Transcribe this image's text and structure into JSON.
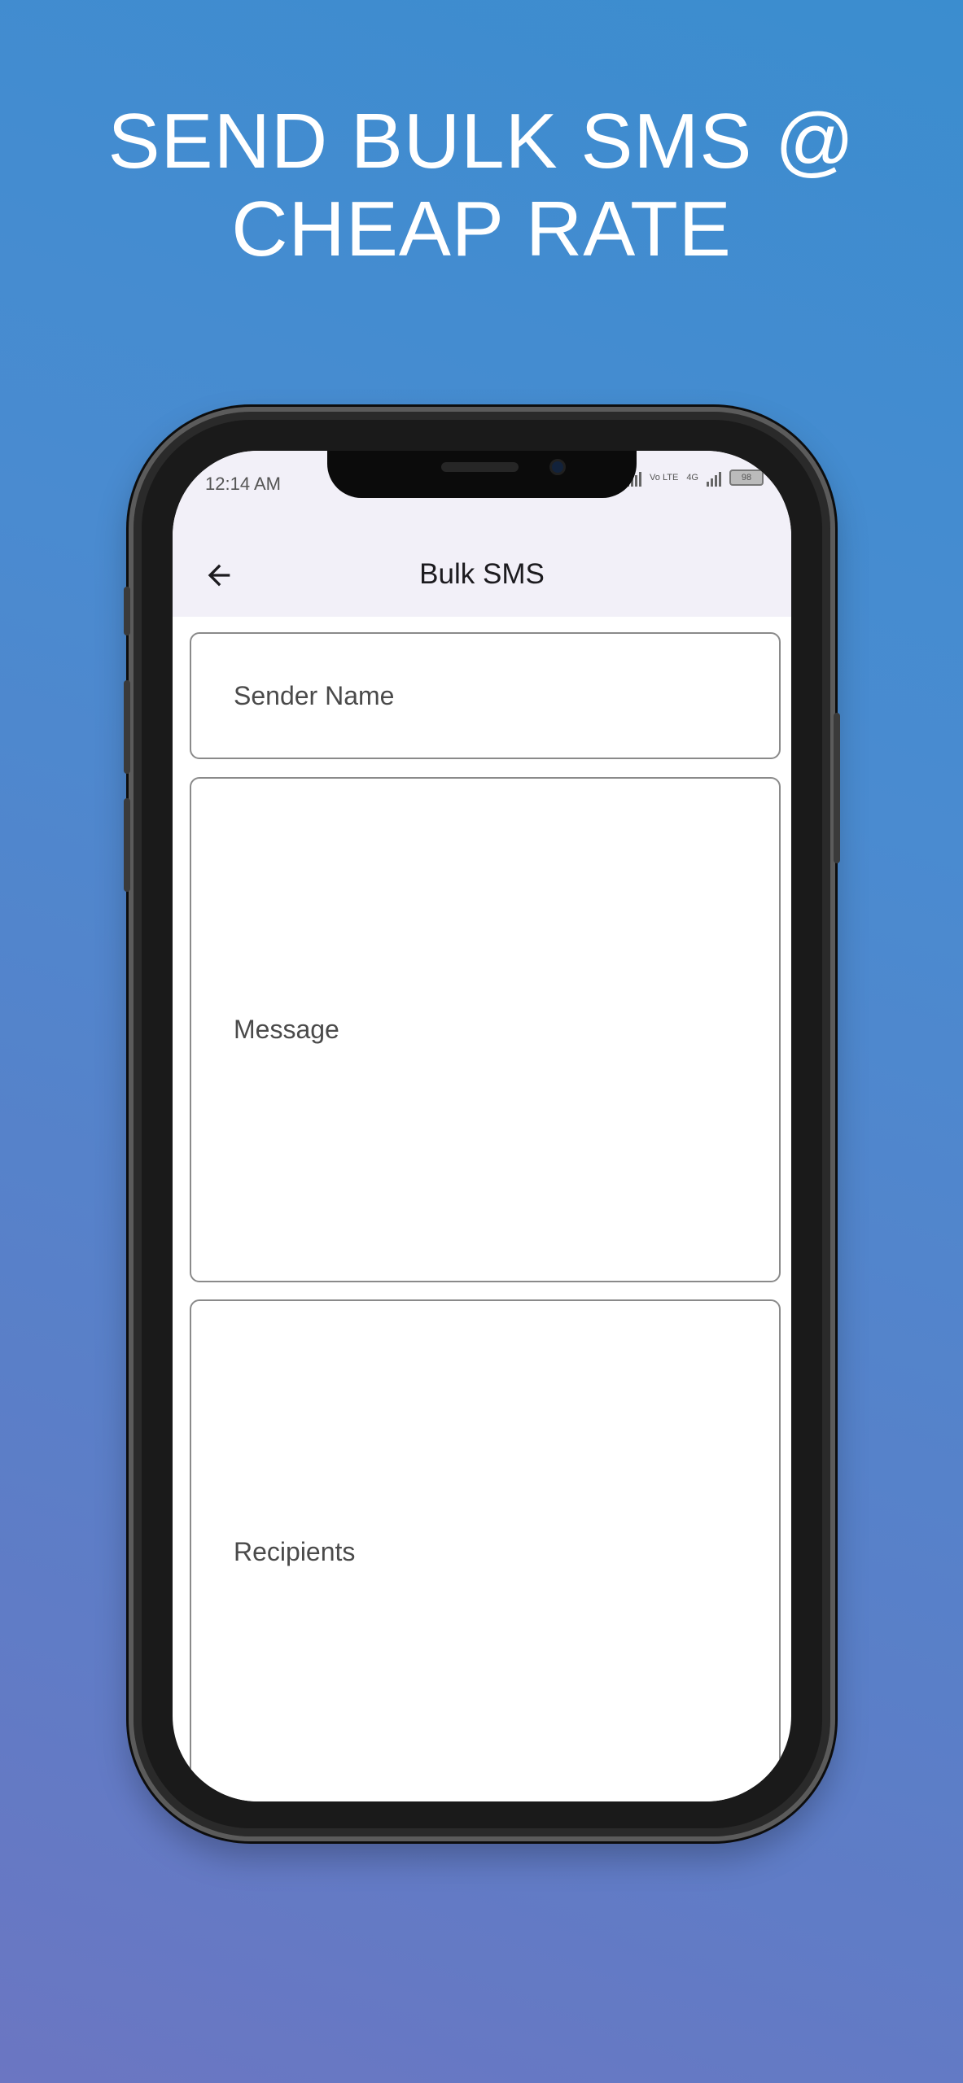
{
  "headline": {
    "line1": "SEND BULK SMS @",
    "line2": "CHEAP RATE"
  },
  "status_bar": {
    "time": "12:14 AM",
    "network1": "4G",
    "network2": "Vo LTE",
    "network3": "4G",
    "battery": "98"
  },
  "appbar": {
    "back_icon": "arrow-left-icon",
    "title": "Bulk SMS"
  },
  "form": {
    "sender_name_label": "Sender Name",
    "message_label": "Message",
    "recipients_label": "Recipients"
  },
  "colors": {
    "background_top": "#3b8dcf",
    "background_bottom": "#6b76c2",
    "appbar": "#f2f0f8",
    "field_border": "#8a8a8a"
  }
}
